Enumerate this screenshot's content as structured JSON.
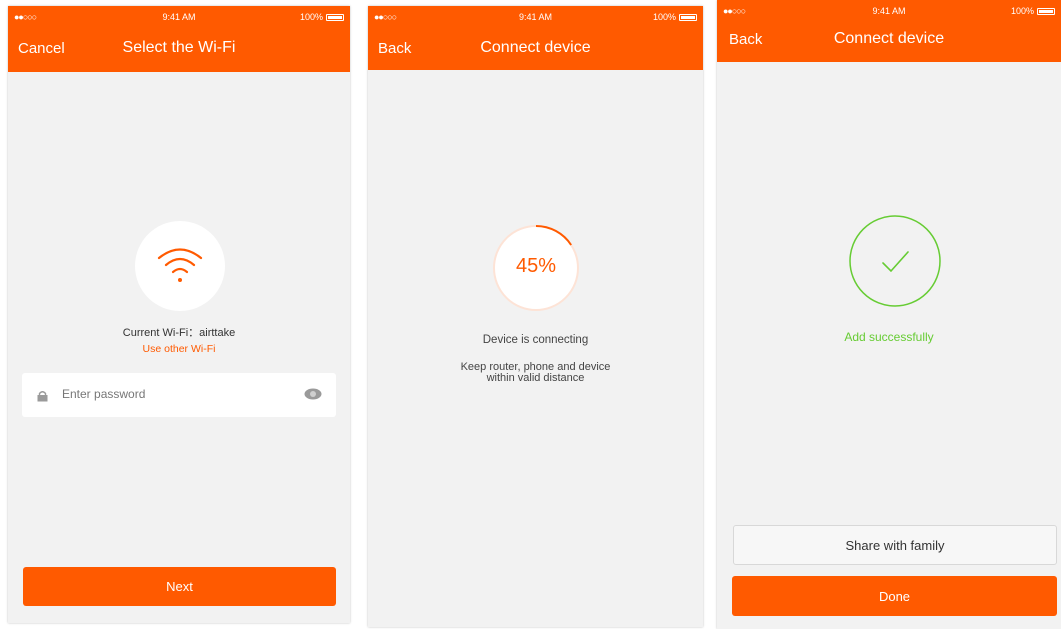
{
  "colors": {
    "accent": "#ff5a00",
    "success": "#66cc33",
    "background": "#f2f2f2"
  },
  "status_bar": {
    "signal": "●●○○○ ",
    "time": "9:41 AM",
    "battery": "100%"
  },
  "screen1": {
    "nav_left": "Cancel",
    "title": "Select the Wi-Fi",
    "current_wifi": "Current Wi-Fi：airttake",
    "use_other": "Use other Wi-Fi",
    "password_placeholder": "Enter password",
    "next_button": "Next",
    "icons": [
      "wifi-icon",
      "lock-icon",
      "eye-icon"
    ]
  },
  "screen2": {
    "nav_left": "Back",
    "title": "Connect device",
    "progress": 45,
    "progress_label": "45%",
    "status": "Device is connecting",
    "hint_line1": "Keep router, phone and device",
    "hint_line2": "within valid distance"
  },
  "screen3": {
    "nav_left": "Back",
    "title": "Connect device",
    "success_text": "Add successfully",
    "share_button": "Share with family",
    "done_button": "Done",
    "icons": [
      "check-icon"
    ]
  }
}
